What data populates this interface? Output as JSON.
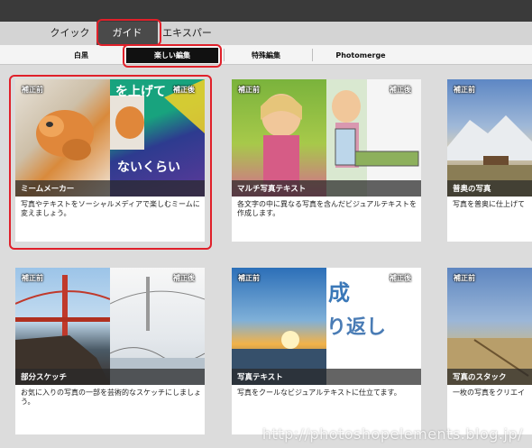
{
  "mode_tabs": [
    {
      "label": "クイック"
    },
    {
      "label": "ガイド"
    },
    {
      "label": "エキスパート"
    }
  ],
  "sub_tabs": [
    {
      "label": "白黒"
    },
    {
      "label": "楽しい編集"
    },
    {
      "label": "特殊編集"
    },
    {
      "label": "Photomerge"
    }
  ],
  "cards": [
    {
      "title": "ミームメーカー",
      "before": "補正前",
      "after": "補正後",
      "desc": "写真やテキストをソーシャルメディアで楽しむミームに変えましょう。",
      "overlay_top": "を上げて",
      "overlay_bottom": "ないくらい"
    },
    {
      "title": "マルチ写真テキスト",
      "before": "補正前",
      "after": "補正後",
      "desc": "各文字の中に異なる写真を含んだビジュアルテキストを作成します。"
    },
    {
      "title": "普奥の写真",
      "before": "補正前",
      "after": "",
      "desc": "写真を普奥に仕上げて"
    },
    {
      "title": "部分スケッチ",
      "before": "補正前",
      "after": "補正後",
      "desc": "お気に入りの写真の一部を芸術的なスケッチにしましょう。"
    },
    {
      "title": "写真テキスト",
      "before": "補正前",
      "after": "補正後",
      "desc": "写真をクールなビジュアルテキストに仕立てます。",
      "overlay_top": "成",
      "overlay_bottom": "り返し"
    },
    {
      "title": "写真のスタック",
      "before": "補正前",
      "after": "",
      "desc": "一枚の写真をクリエイ"
    }
  ],
  "watermark": "http://photoshopelements.blog.jp/",
  "colors": {
    "highlight": "#e0202a",
    "active_tab": "#4a4a4a",
    "active_subtab": "#111111"
  }
}
